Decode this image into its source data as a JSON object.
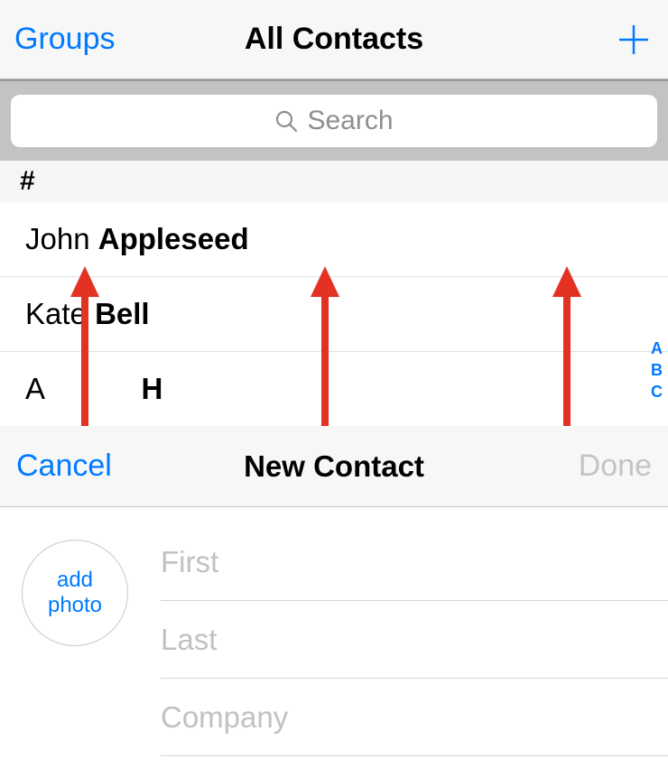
{
  "nav": {
    "groups_label": "Groups",
    "title": "All Contacts"
  },
  "search": {
    "placeholder": "Search"
  },
  "section_header": "#",
  "contacts": [
    {
      "first": "John",
      "last": "Appleseed"
    },
    {
      "first": "Kate",
      "last": "Bell"
    }
  ],
  "partial_contact": {
    "first_initial": "A",
    "last_initial": "H"
  },
  "alpha_index": [
    "A",
    "B",
    "C"
  ],
  "sheet": {
    "cancel_label": "Cancel",
    "title": "New Contact",
    "done_label": "Done",
    "add_photo_line1": "add",
    "add_photo_line2": "photo",
    "fields": {
      "first_placeholder": "First",
      "last_placeholder": "Last",
      "company_placeholder": "Company"
    }
  }
}
